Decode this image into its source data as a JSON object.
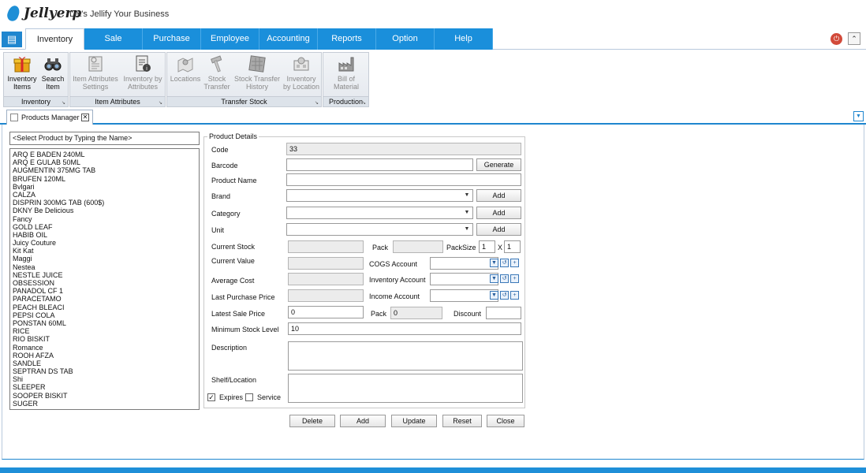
{
  "app": {
    "logo": "Jellyerp",
    "tagline": "Let's Jellify Your Business"
  },
  "tabs": [
    "Inventory",
    "Sale",
    "Purchase",
    "Employee",
    "Accounting",
    "Reports",
    "Option",
    "Help"
  ],
  "active_tab": "Inventory",
  "ribbon": {
    "groups": [
      {
        "label": "Inventory",
        "buttons": [
          {
            "label1": "Inventory",
            "label2": "Items",
            "icon": "gift-box-icon"
          },
          {
            "label1": "Search",
            "label2": "Item",
            "icon": "binoculars-icon"
          }
        ]
      },
      {
        "label": "Item Attributes",
        "buttons": [
          {
            "label1": "Item Attributes",
            "label2": "Settings",
            "icon": "attributes-settings-icon"
          },
          {
            "label1": "Inventory by",
            "label2": "Attributes",
            "icon": "document-info-icon"
          }
        ]
      },
      {
        "label": "Transfer Stock",
        "buttons": [
          {
            "label1": "Locations",
            "label2": "",
            "icon": "map-pin-icon"
          },
          {
            "label1": "Stock",
            "label2": "Transfer",
            "icon": "hammer-icon"
          },
          {
            "label1": "Stock Transfer",
            "label2": "History",
            "icon": "history-grid-icon"
          },
          {
            "label1": "Inventory",
            "label2": "by Location",
            "icon": "location-inventory-icon"
          }
        ]
      },
      {
        "label": "Production",
        "buttons": [
          {
            "label1": "Bill of",
            "label2": "Material",
            "icon": "factory-icon"
          }
        ]
      }
    ]
  },
  "doc_tab": {
    "label": "Products Manager",
    "close": "✕"
  },
  "search_placeholder": "<Select Product by Typing the Name>",
  "products": [
    "ARQ E BADEN 240ML",
    "ARQ E GULAB 50ML",
    "AUGMENTIN  375MG TAB",
    "BRUFEN 120ML",
    "Bvlgari",
    "CALZA",
    "DISPRIN  300MG TAB (600$)",
    "DKNY Be Delicious",
    "Fancy",
    "GOLD LEAF",
    "HABIB OIL",
    "Juicy Couture",
    "Kit Kat",
    "Maggi",
    "Nestea",
    "NESTLE JUICE",
    "OBSESSION",
    "PANADOL CF 1",
    "PARACETAMO",
    "PEACH BLEACI",
    "PEPSI COLA",
    "PONSTAN 60ML",
    "RICE",
    "RIO BISKIT",
    "Romance",
    "ROOH AFZA",
    "SANDLE",
    "SEPTRAN DS TAB",
    "Shi",
    "SLEEPER",
    "SOOPER BISKIT",
    "SUGER"
  ],
  "details": {
    "legend": "Product Details",
    "labels": {
      "code": "Code",
      "barcode": "Barcode",
      "product_name": "Product Name",
      "brand": "Brand",
      "category": "Category",
      "unit": "Unit",
      "current_stock": "Current Stock",
      "current_value": "Current Value",
      "average_cost": "Average Cost",
      "last_purchase_price": "Last Purchase Price",
      "latest_sale_price": "Latest Sale Price",
      "minimum_stock_level": "Minimum Stock Level",
      "description": "Description",
      "shelf_location": "Shelf/Location",
      "pack": "Pack",
      "packsize": "PackSize",
      "x": "X",
      "cogs_account": "COGS Account",
      "inventory_account": "Inventory Account",
      "income_account": "Income Account",
      "pack2": "Pack",
      "discount": "Discount",
      "expires": "Expires",
      "service": "Service"
    },
    "values": {
      "code": "33",
      "packsize_a": "1",
      "packsize_b": "1",
      "latest_sale_price": "0",
      "pack2": "0",
      "minimum_stock_level": "10"
    },
    "generate": "Generate",
    "add": "Add",
    "expires_checked": true,
    "service_checked": false
  },
  "actions": [
    "Delete",
    "Add",
    "Update",
    "Reset",
    "Close"
  ]
}
